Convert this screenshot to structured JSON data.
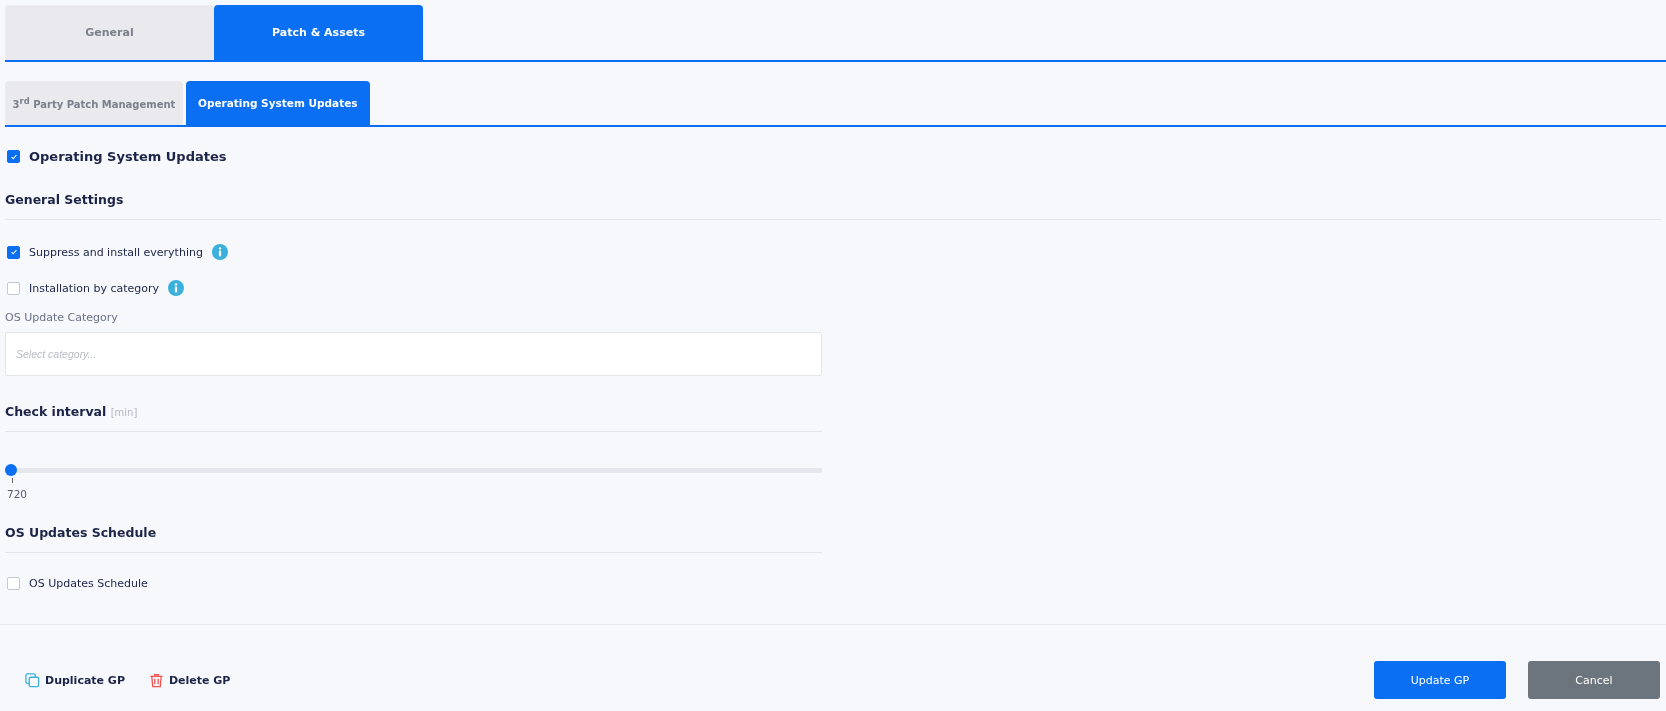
{
  "tabs": [
    {
      "label": "General",
      "selected": false
    },
    {
      "label": "Patch & Assets",
      "selected": true
    }
  ],
  "subtabs": [
    {
      "label": "3$^{rd}$ Party Patch Management",
      "selected": false
    },
    {
      "label": "Operating System Updates",
      "selected": true
    }
  ],
  "main_toggle": {
    "label": "Operating System Updates",
    "checked": true
  },
  "general_settings": {
    "heading": "General Settings",
    "options": [
      {
        "label": "Suppress and install everything",
        "checked": true,
        "info": true
      },
      {
        "label": "Installation by category",
        "checked": false,
        "info": true
      }
    ],
    "category_field": {
      "label": "OS Update Category",
      "placeholder": "Select category..."
    }
  },
  "check_interval": {
    "heading": "Check interval",
    "unit": "[min]",
    "level": 0,
    "reading": "720"
  },
  "schedule": {
    "heading": "OS Updates Schedule",
    "option": {
      "label": "OS Updates Schedule",
      "checked": false
    }
  },
  "footer": {
    "links": [
      {
        "kind": "duplicate",
        "label": "Duplicate GP"
      },
      {
        "kind": "delete",
        "label": "Delete GP"
      }
    ],
    "buttons": [
      {
        "kind": "primary",
        "label": "Update GP"
      },
      {
        "kind": "secondary",
        "label": "Cancel"
      }
    ]
  }
}
